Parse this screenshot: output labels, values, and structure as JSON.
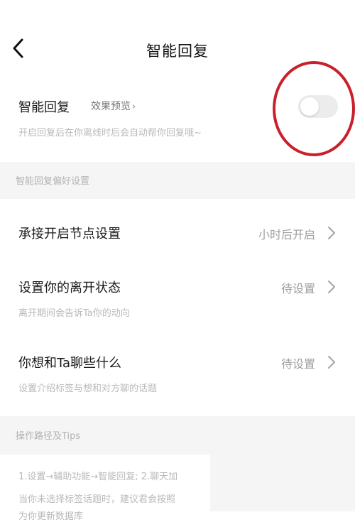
{
  "header": {
    "title": "智能回复",
    "back_icon": "chevron-left-icon"
  },
  "smart_reply": {
    "label": "智能回复",
    "preview_label": "效果预览",
    "description": "开启回复后在你离线时后会自动帮你回复哦~",
    "toggle_on": false
  },
  "preferences": {
    "section_title": "智能回复偏好设置",
    "rows": [
      {
        "label": "承接开启节点设置",
        "value": "小时后开启",
        "description": ""
      },
      {
        "label": "设置你的离开状态",
        "value": "待设置",
        "description": "离开期间会告诉Ta你的动向"
      },
      {
        "label": "你想和Ta聊些什么",
        "value": "待设置",
        "description": "设置介绍标签与想和对方聊的话题"
      }
    ]
  },
  "tips": {
    "section_title": "操作路径及Tips",
    "lines": [
      "1.设置→辅助功能→智能回复; 2.聊天加",
      "当你未选择标签话题时，建议君会按照",
      "为你更新数据库"
    ]
  },
  "colors": {
    "annotation_ring": "#c9202c",
    "toggle_off": "#ececec",
    "section_bg": "#f5f5f5"
  }
}
